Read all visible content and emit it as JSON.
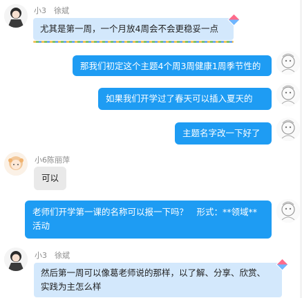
{
  "messages": [
    {
      "sender": "小3　徐斌",
      "text": "尤其是第一周，一个月放4周会不会更稳妥一点"
    },
    {
      "text": "那我们初定这个主题4个周3周健康1周季节性的"
    },
    {
      "text": "如果我们开学过了春天可以插入夏天的"
    },
    {
      "text": "主题名字改一下好了"
    },
    {
      "sender": "小6陈丽萍",
      "text": "可以"
    },
    {
      "text_line1": "老师们开学第一课的名称可以报一下吗？　形式：**领域**",
      "text_line2": "活动"
    },
    {
      "sender": "小3　徐斌",
      "text_line1": "然后第一周可以像葛老师说的那样，以了解、分享、欣赏、",
      "text_line2": "实践为主怎么样"
    }
  ]
}
